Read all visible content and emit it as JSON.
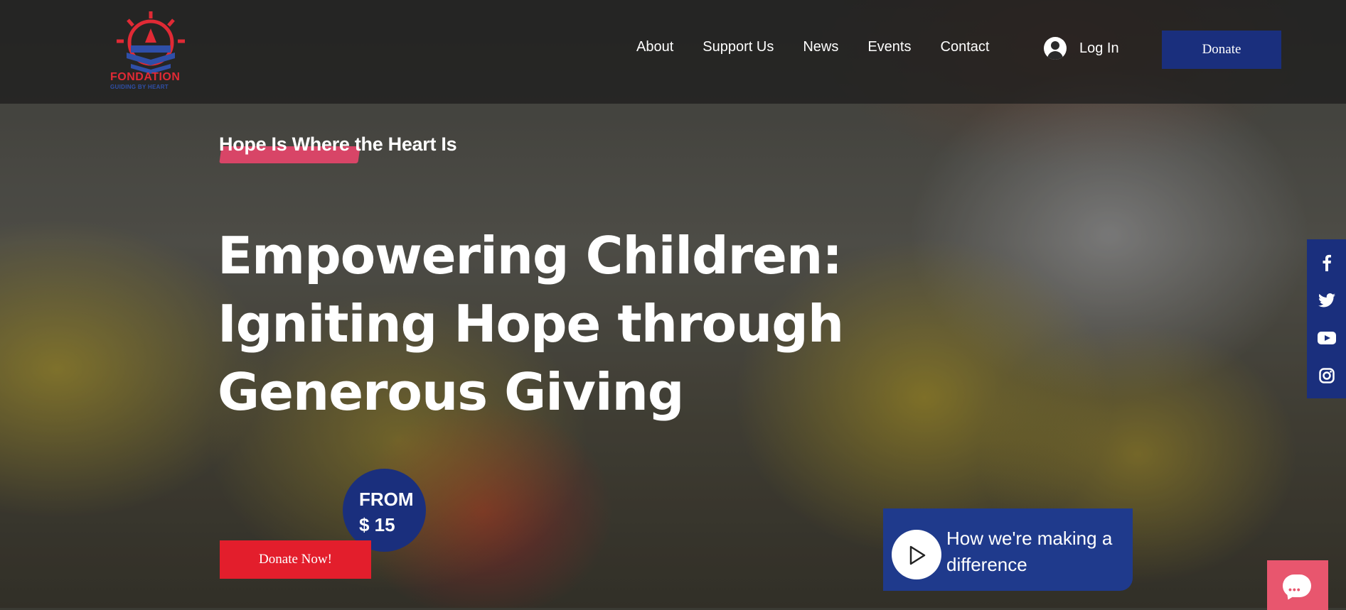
{
  "logo": {
    "text": "FONDATION",
    "subtext": "GUIDING BY HEART"
  },
  "nav": {
    "items": [
      "About",
      "Support Us",
      "News",
      "Events",
      "Contact"
    ]
  },
  "header": {
    "login_label": "Log In",
    "donate_label": "Donate"
  },
  "hero": {
    "tagline": "Hope Is Where the Heart Is",
    "headline_lines": [
      "Empowering Children:",
      "Igniting Hope through",
      "Generous Giving"
    ],
    "badge_from": "FROM",
    "badge_price": "$ 15",
    "donate_now_label": "Donate Now!",
    "video_text": "How we're making a difference"
  },
  "social": {
    "icons": [
      "facebook-icon",
      "twitter-icon",
      "youtube-icon",
      "instagram-icon"
    ]
  },
  "colors": {
    "brand_blue": "#1a2f7d",
    "brand_red": "#e31e2c",
    "highlight_pink": "#e8456b",
    "chat_pink": "#e8566e"
  }
}
